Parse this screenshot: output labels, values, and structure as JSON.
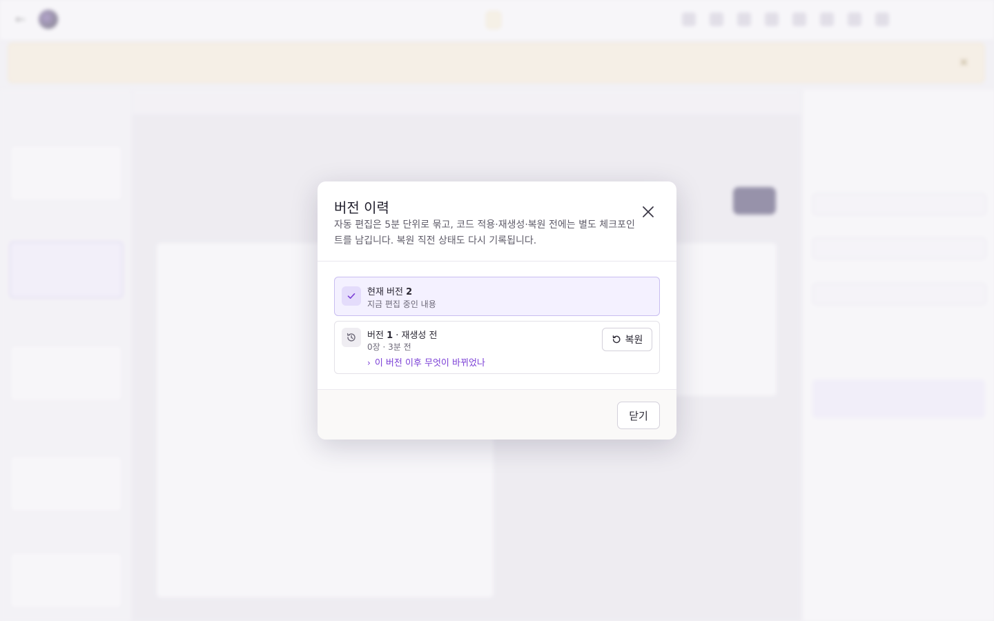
{
  "modal": {
    "title": "버전 이력",
    "description": "자동 편집은 5분 단위로 묶고, 코드 적용·재생성·복원 전에는 별도 체크포인트를 남깁니다. 복원 직전 상태도 다시 기록됩니다.",
    "current": {
      "label": "현재 버전",
      "number": "2",
      "subtitle": "지금 편집 중인 내용"
    },
    "versions": [
      {
        "label": "버전",
        "number": "1",
        "tag": "· 재생성 전",
        "meta": "0장 · 3분 전",
        "diff_label": "이 버전 이후 무엇이 바뀌었나",
        "restore_label": "복원"
      }
    ],
    "close_label": "닫기"
  },
  "icons": {
    "close": "close-icon",
    "check": "check-icon",
    "history": "history-icon",
    "restore": "rotate-ccw-icon",
    "chevron": "chevron-right-icon"
  },
  "colors": {
    "accent": "#7b3fd6",
    "current_card_bg": "#f4f1ff"
  }
}
